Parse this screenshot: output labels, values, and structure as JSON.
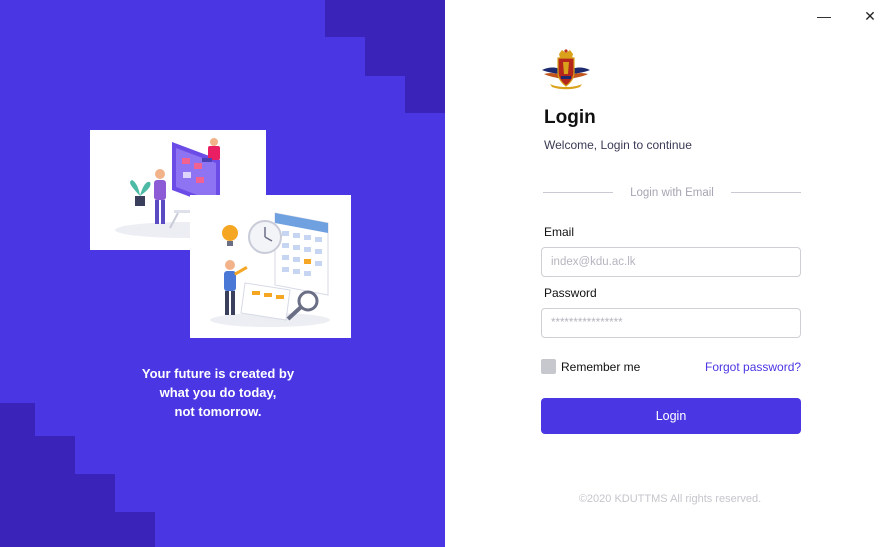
{
  "window": {
    "minimize_label": "—",
    "close_label": "✕"
  },
  "hero": {
    "tagline_lines": [
      "Your future is created by",
      "what you do today,",
      "not tomorrow."
    ]
  },
  "login": {
    "title": "Login",
    "subtitle": "Welcome, Login to continue",
    "divider_text": "Login with Email",
    "email_label": "Email",
    "email_placeholder": "index@kdu.ac.lk",
    "email_value": "",
    "password_label": "Password",
    "password_placeholder": "****************",
    "password_value": "",
    "remember_label": "Remember me",
    "remember_checked": false,
    "forgot_label": "Forgot password?",
    "submit_label": "Login"
  },
  "footer": {
    "copyright": "©2020 KDUTTMS All rights reserved."
  },
  "colors": {
    "accent": "#4a36e3",
    "accent_dark": "#3a23b8",
    "link": "#4a36e3"
  }
}
